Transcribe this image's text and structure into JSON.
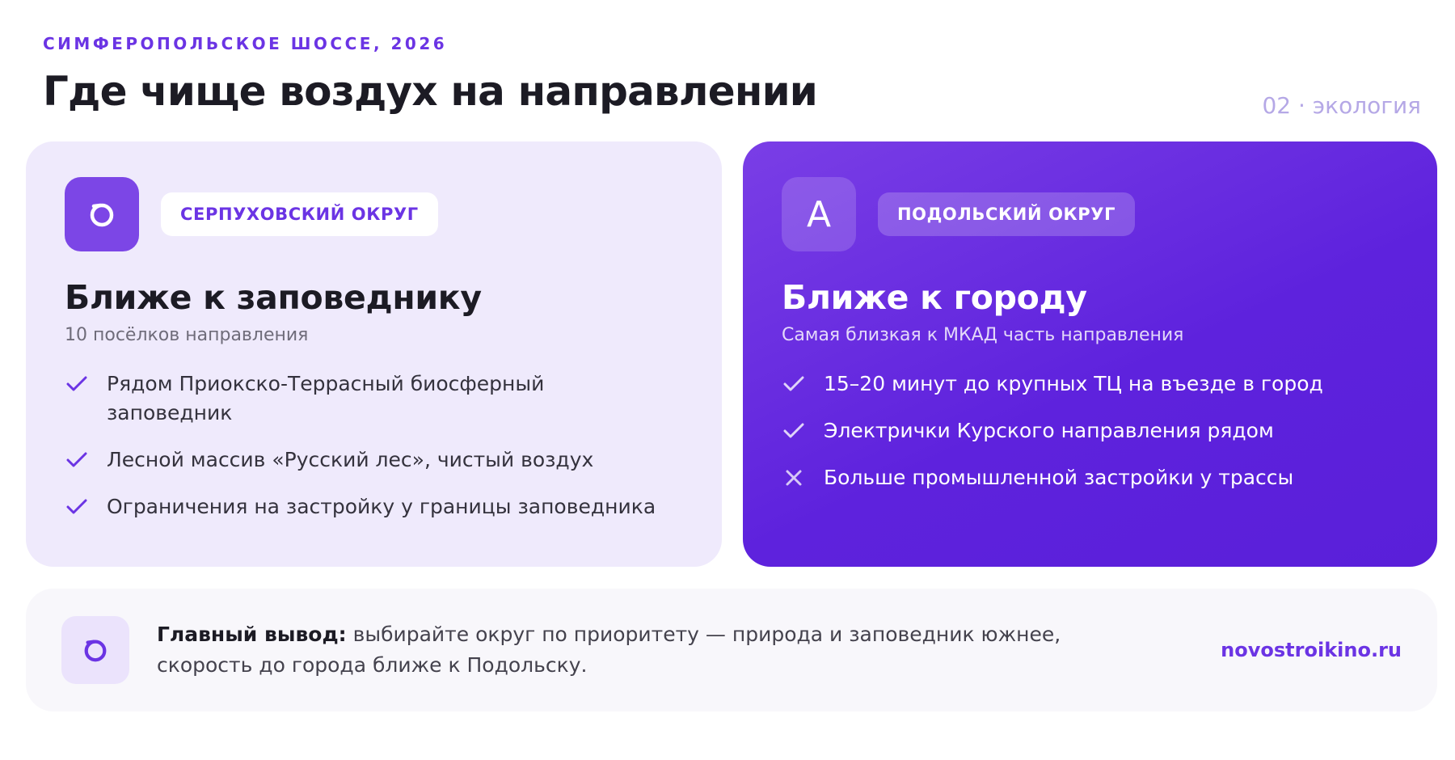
{
  "header": {
    "eyebrow": "СИМФЕРОПОЛЬСКОЕ ШОССЕ, 2026",
    "title": "Где чище воздух на направлении",
    "section_tag": "02 · экология"
  },
  "cards": [
    {
      "badge": {
        "icon": "ring-icon"
      },
      "chip": "СЕРПУХОВСКИЙ ОКРУГ",
      "title": "Ближе к заповеднику",
      "subtitle": "10 посёлков направления",
      "items": [
        {
          "mark": "check-icon",
          "text": "Рядом Приокско-Террасный биосферный заповедник"
        },
        {
          "mark": "check-icon",
          "text": "Лесной массив «Русский лес», чистый воздух"
        },
        {
          "mark": "check-icon",
          "text": "Ограничения на застройку у границы заповедника"
        }
      ]
    },
    {
      "badge": {
        "letter": "A"
      },
      "chip": "ПОДОЛЬСКИЙ ОКРУГ",
      "title": "Ближе к городу",
      "subtitle": "Самая близкая к МКАД часть направления",
      "items": [
        {
          "mark": "check-icon",
          "text": "15–20 минут до крупных ТЦ на въезде в город"
        },
        {
          "mark": "check-icon",
          "text": "Электрички Курского направления рядом"
        },
        {
          "mark": "cross-icon",
          "text": "Больше промышленной застройки у трассы"
        }
      ]
    }
  ],
  "summary": {
    "icon": "ring-icon",
    "lead": "Главный вывод:",
    "text": " выбирайте округ по приоритету — природа и заповедник южнее, скорость до города ближе к Подольску.",
    "brand": "novostroikino.ru"
  },
  "colors": {
    "accent": "#6b34e4",
    "card_left_bg": "#efeafc",
    "card_right_bg": "#5e22dd",
    "muted": "#b5a8e6"
  }
}
